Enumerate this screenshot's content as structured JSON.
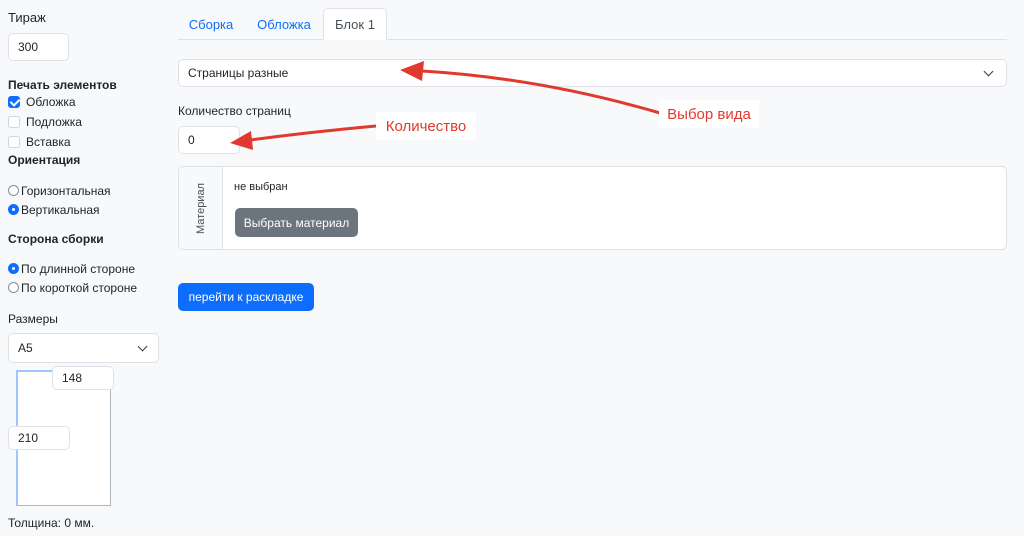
{
  "sidebar": {
    "tirazh_label": "Тираж",
    "tirazh_value": "300",
    "print_title": "Печать элементов",
    "print_items": [
      {
        "label": "Обложка",
        "checked": true
      },
      {
        "label": "Подложка",
        "checked": false
      },
      {
        "label": "Вставка",
        "checked": false
      }
    ],
    "orientation_title": "Ориентация",
    "orientation_options": [
      {
        "label": "Горизонтальная",
        "selected": false
      },
      {
        "label": "Вертикальная",
        "selected": true
      }
    ],
    "binding_title": "Сторона сборки",
    "binding_options": [
      {
        "label": "По длинной стороне",
        "selected": true
      },
      {
        "label": "По короткой стороне",
        "selected": false
      }
    ],
    "sizes_label": "Размеры",
    "size_select_value": "A5",
    "width_value": "148",
    "height_value": "210",
    "thickness_text": "Толщина: 0 мм."
  },
  "tabs": [
    {
      "label": "Сборка",
      "active": false
    },
    {
      "label": "Обложка",
      "active": false
    },
    {
      "label": "Блок 1",
      "active": true
    }
  ],
  "main": {
    "page_type_value": "Страницы разные",
    "page_count_label": "Количество страниц",
    "page_count_value": "0",
    "material_side_label": "Материал",
    "material_status": "не выбран",
    "choose_material_button": "Выбрать материал",
    "layout_button": "перейти к раскладке"
  },
  "annotations": {
    "select_type": "Выбор вида",
    "quantity": "Количество"
  },
  "colors": {
    "primary": "#0d6efd",
    "secondary": "#6c757d",
    "annotation": "#e03a2e"
  }
}
